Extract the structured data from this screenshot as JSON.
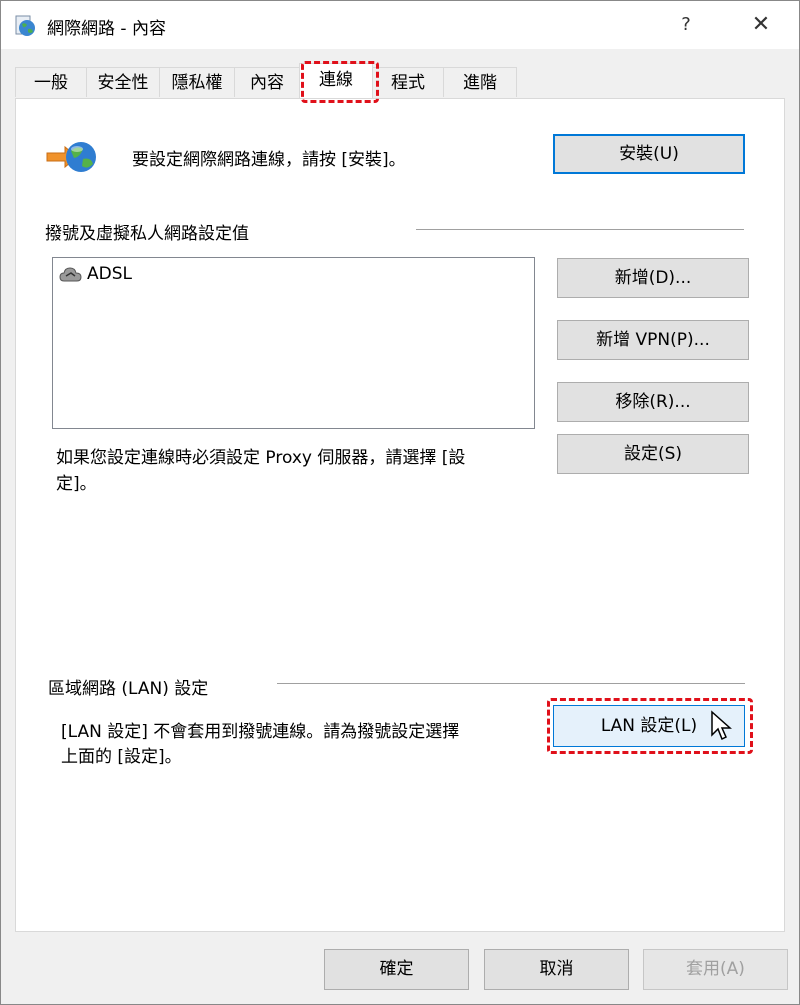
{
  "window": {
    "title": "網際網路 - 內容",
    "help": "?",
    "close": "✕"
  },
  "tabs": [
    {
      "label": "一般"
    },
    {
      "label": "安全性"
    },
    {
      "label": "隱私權"
    },
    {
      "label": "內容"
    },
    {
      "label": "連線",
      "active": true
    },
    {
      "label": "程式"
    },
    {
      "label": "進階"
    }
  ],
  "setup": {
    "text": "要設定網際網路連線，請按 [安裝]。",
    "button": "安裝(U)"
  },
  "dialup": {
    "heading": "撥號及虛擬私人網路設定值",
    "items": [
      {
        "label": "ADSL"
      }
    ],
    "add_button": "新增(D)...",
    "add_vpn_button": "新增 VPN(P)...",
    "remove_button": "移除(R)...",
    "settings_button": "設定(S)",
    "proxy_note_line1": "如果您設定連線時必須設定 Proxy 伺服器，請選擇 [設",
    "proxy_note_line2": "定]。"
  },
  "lan": {
    "heading": "區域網路 (LAN) 設定",
    "note_line1": "[LAN 設定] 不會套用到撥號連線。請為撥號設定選擇",
    "note_line2": "上面的 [設定]。",
    "button": "LAN 設定(L)"
  },
  "footer": {
    "ok": "確定",
    "cancel": "取消",
    "apply": "套用(A)"
  },
  "colors": {
    "highlight": "#e0101a",
    "focus": "#0078d7"
  }
}
